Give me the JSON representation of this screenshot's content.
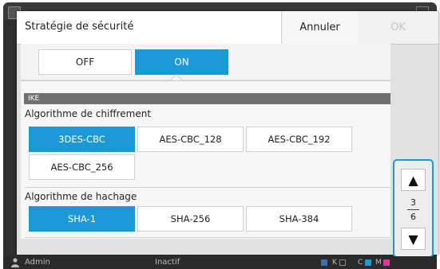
{
  "dialog": {
    "title": "Stratégie de sécurité",
    "cancel_label": "Annuler",
    "ok_label": "OK"
  },
  "toggle": {
    "off_label": "OFF",
    "on_label": "ON",
    "selected": "ON"
  },
  "section": {
    "header": "IKE",
    "encryption": {
      "label": "Algorithme de chiffrement",
      "options": [
        "3DES-CBC",
        "AES-CBC_128",
        "AES-CBC_192",
        "AES-CBC_256"
      ],
      "selected": "3DES-CBC"
    },
    "hash": {
      "label": "Algorithme de hachage",
      "options": [
        "SHA-1",
        "SHA-256",
        "SHA-384"
      ],
      "selected": "SHA-1"
    }
  },
  "pagination": {
    "up_icon": "▲",
    "down_icon": "▼",
    "current": "3",
    "total": "6"
  },
  "status": {
    "user": "Admin",
    "state": "Inactif",
    "inks": [
      "K",
      "C",
      "M"
    ]
  },
  "colors": {
    "accent": "#1b98d6",
    "magenta": "#d63a9a",
    "cyan": "#1b98d6"
  }
}
